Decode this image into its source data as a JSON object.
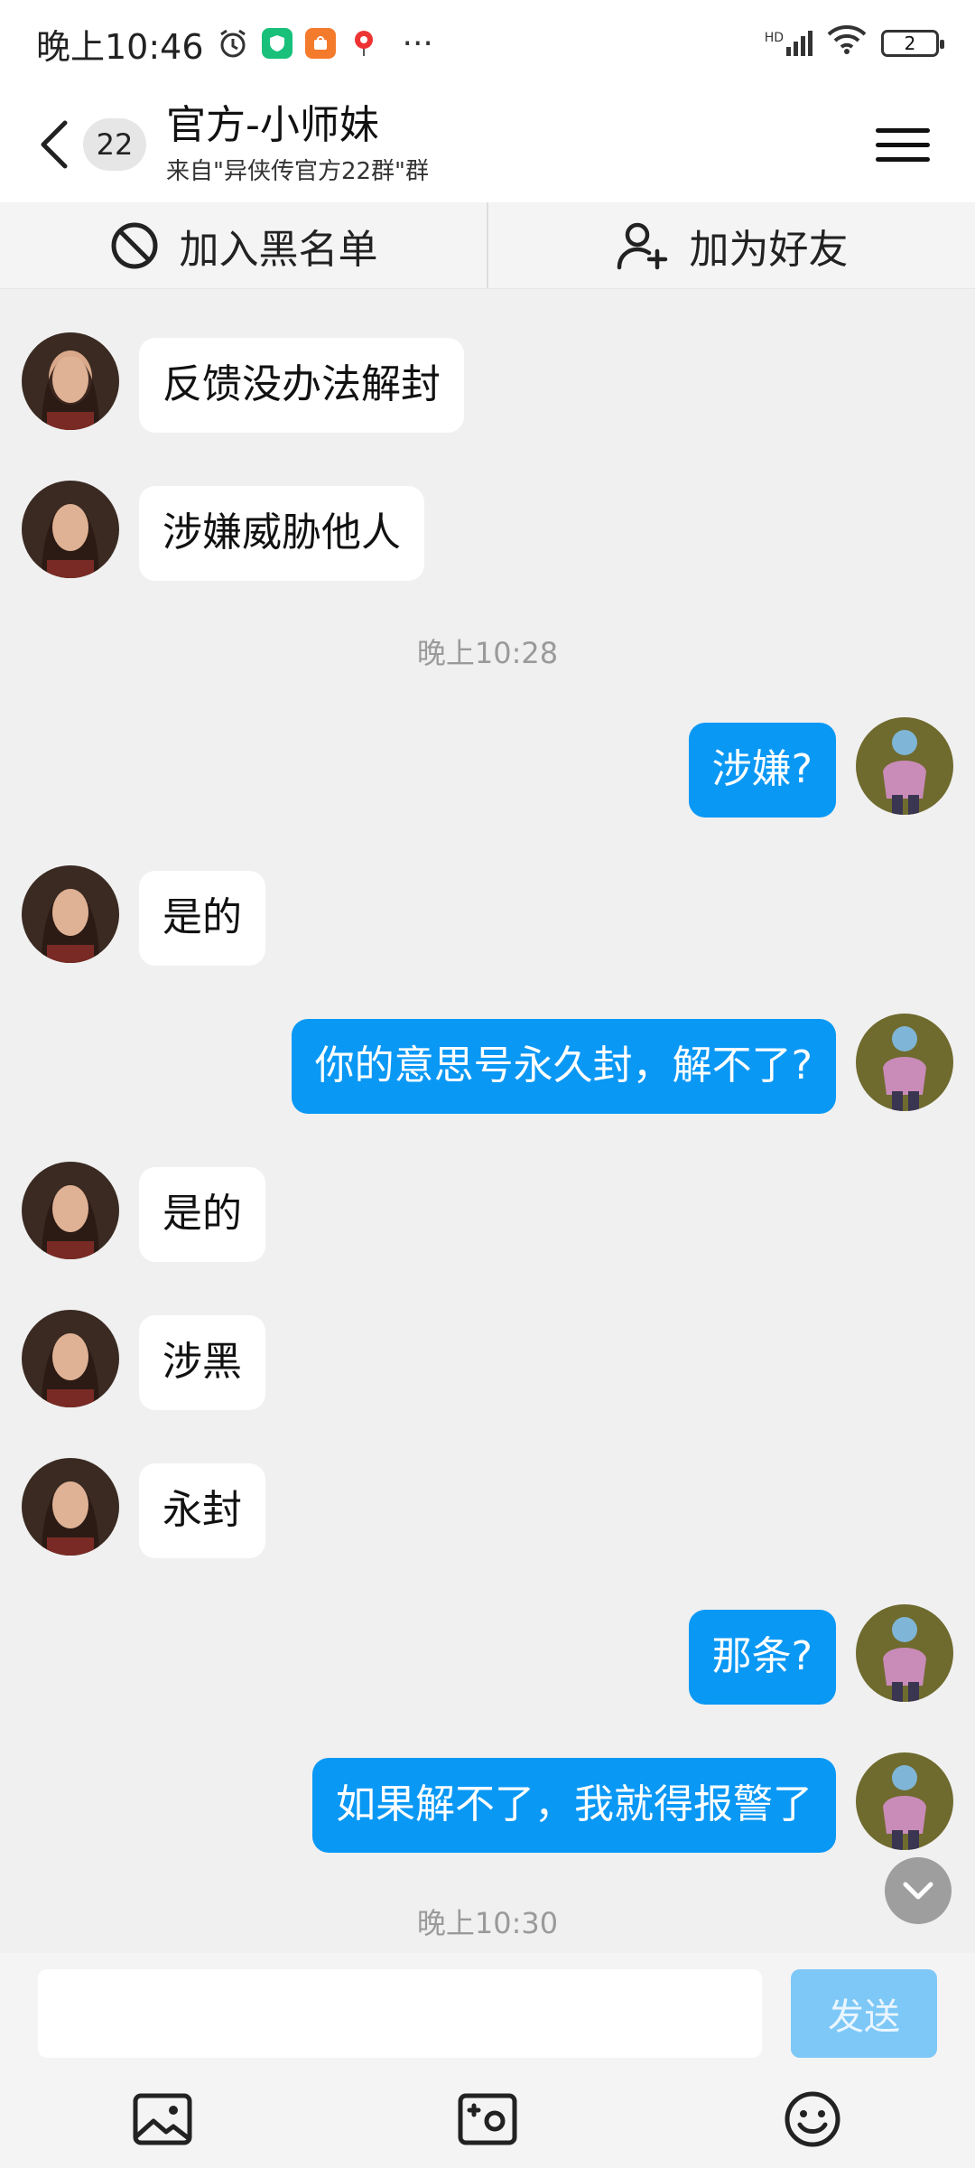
{
  "status_bar": {
    "time": "晚上10:46",
    "more": "···",
    "network": "HD",
    "battery": "2"
  },
  "header": {
    "unread_count": "22",
    "title": "官方-小师妹",
    "subtitle": "来自\"异侠传官方22群\"群"
  },
  "actions": {
    "blacklist": "加入黑名单",
    "add_friend": "加为好友"
  },
  "messages": [
    {
      "side": "left",
      "text": "反馈没办法解封"
    },
    {
      "side": "left",
      "text": "涉嫌威胁他人"
    },
    {
      "timestamp": "晚上10:28"
    },
    {
      "side": "right",
      "text": "涉嫌?"
    },
    {
      "side": "left",
      "text": "是的"
    },
    {
      "side": "right",
      "text": "你的意思号永久封，解不了?"
    },
    {
      "side": "left",
      "text": "是的"
    },
    {
      "side": "left",
      "text": "涉黑"
    },
    {
      "side": "left",
      "text": "永封"
    },
    {
      "side": "right",
      "text": "那条?"
    },
    {
      "side": "right",
      "text": "如果解不了，我就得报警了"
    },
    {
      "timestamp": "晚上10:30"
    }
  ],
  "input": {
    "value": "",
    "send_label": "发送"
  },
  "toolbar_icons": [
    "image-icon",
    "camera-icon",
    "emoji-icon"
  ],
  "colors": {
    "accent": "#0a98f5",
    "send_disabled": "#7ec8f7",
    "background": "#f0f0f0"
  }
}
